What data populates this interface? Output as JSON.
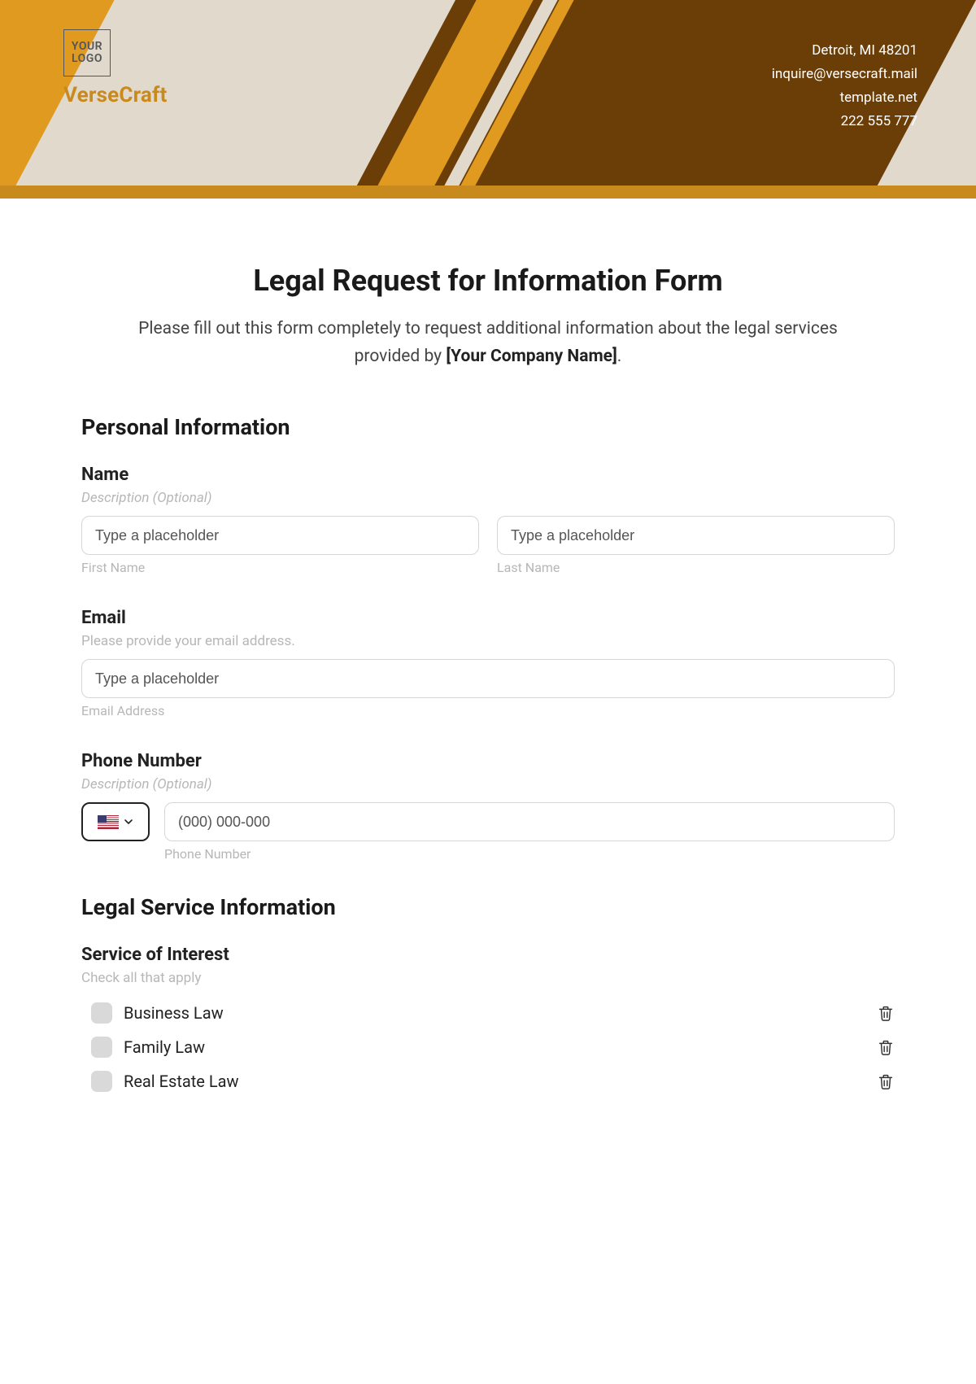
{
  "header": {
    "logo_line1": "YOUR",
    "logo_line2": "LOGO",
    "brand": "VerseCraft",
    "contact": {
      "address": "Detroit, MI 48201",
      "email": "inquire@versecraft.mail",
      "site": "template.net",
      "phone": "222 555 777"
    }
  },
  "form": {
    "title": "Legal Request for Information Form",
    "intro_pre": "Please fill out this form completely to request additional information about the legal services provided by ",
    "intro_bold": "[Your Company Name]",
    "intro_post": "."
  },
  "personal": {
    "heading": "Personal Information",
    "name": {
      "label": "Name",
      "desc": "Description (Optional)",
      "first_ph": "Type a placeholder",
      "first_sub": "First Name",
      "last_ph": "Type a placeholder",
      "last_sub": "Last Name"
    },
    "email": {
      "label": "Email",
      "desc": "Please provide your email address.",
      "ph": "Type a placeholder",
      "sub": "Email Address"
    },
    "phone": {
      "label": "Phone Number",
      "desc": "Description (Optional)",
      "ph": "(000) 000-000",
      "sub": "Phone Number"
    }
  },
  "legal": {
    "heading": "Legal Service Information",
    "service": {
      "label": "Service of Interest",
      "desc": "Check all that apply",
      "options": [
        "Business Law",
        "Family Law",
        "Real Estate Law"
      ]
    }
  }
}
